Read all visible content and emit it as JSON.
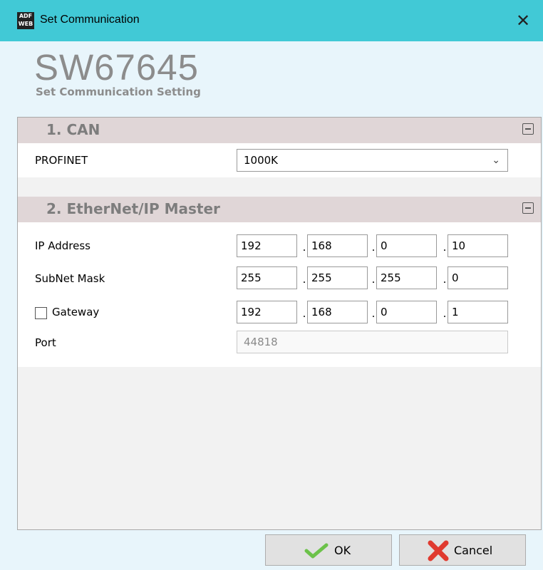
{
  "window": {
    "title": "Set Communication",
    "icon": "adfweb-logo-icon",
    "icon_text": "ADF WEB",
    "close_glyph": "✕"
  },
  "header": {
    "title": "SW67645",
    "subtitle": "Set Communication Setting"
  },
  "sections": [
    {
      "title": "1. CAN",
      "rows": [
        {
          "label": "PROFINET",
          "value": "1000K"
        }
      ]
    },
    {
      "title": "2. EtherNet/IP Master",
      "ip_address": {
        "label": "IP Address",
        "octets": [
          "192",
          "168",
          "0",
          "10"
        ]
      },
      "subnet_mask": {
        "label": "SubNet Mask",
        "octets": [
          "255",
          "255",
          "255",
          "0"
        ]
      },
      "gateway": {
        "label": "Gateway",
        "checked": false,
        "octets": [
          "192",
          "168",
          "0",
          "1"
        ]
      },
      "port": {
        "label": "Port",
        "value": "44818"
      }
    }
  ],
  "buttons": {
    "ok_label": "OK",
    "cancel_label": "Cancel"
  },
  "colors": {
    "titlebar": "#41c9d6",
    "section_header": "#e0d6d7",
    "ok_check": "#6cc24a",
    "cancel_x": "#e03a2f"
  }
}
